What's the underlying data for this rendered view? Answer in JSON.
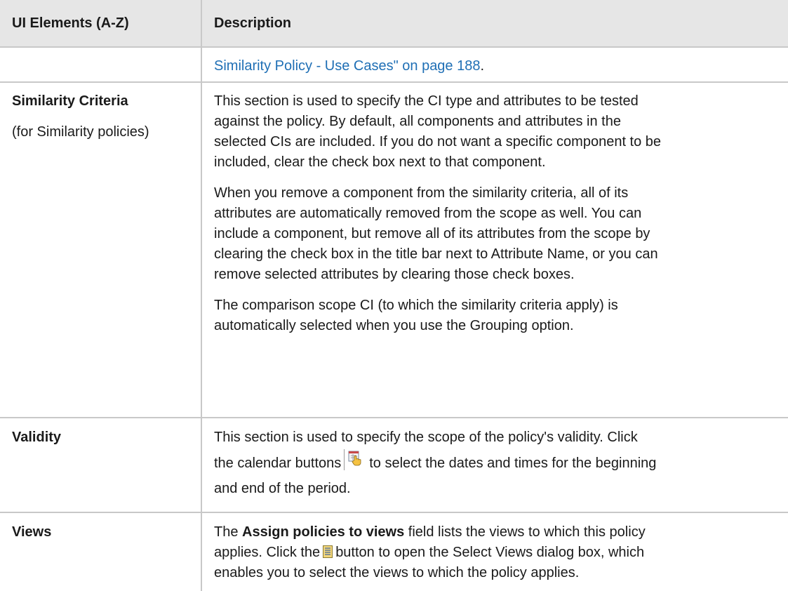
{
  "header": {
    "col1": "UI Elements (A-Z)",
    "col2": "Description"
  },
  "rows": [
    {
      "name": "",
      "desc": {
        "link": "Similarity Policy - Use Cases\" on page 188",
        "after": "."
      }
    },
    {
      "name": "Similarity Criteria",
      "subname": "(for Similarity policies)",
      "paragraphs": [
        [
          "This section is used to specify the CI type and attributes to be tested",
          "against the policy. By default, all components and attributes in the",
          "selected CIs are included. If you do not want a specific component to be",
          "included, clear the check box next to that component."
        ],
        [
          "When you remove a component from the similarity criteria, all of its",
          "attributes are automatically removed from the scope as well. You can",
          "include a component, but remove all of its attributes from the scope by",
          "clearing the check box in the title bar next to Attribute Name, or you can",
          "remove selected attributes by clearing those check boxes."
        ],
        [
          "The comparison scope CI (to which the similarity criteria apply) is",
          "automatically selected when you use the Grouping option."
        ]
      ]
    },
    {
      "name": "Validity",
      "lines": {
        "l1": "This section is used to specify the scope of the policy's validity. Click",
        "l2a": "the calendar buttons",
        "l2b": "to select the dates and times for the beginning",
        "l3": "and end of the period."
      }
    },
    {
      "name": "Views",
      "lines": {
        "l1a": "The",
        "l1bold": "Assign policies to views",
        "l1b": "field lists the views to which this policy",
        "l2a": "applies. Click the",
        "l2b": "button to open the Select Views dialog box, which",
        "l3": "enables you to select the views to which the policy applies."
      }
    }
  ],
  "icons": {
    "calendar": "calendar-icon",
    "views": "views-list-icon"
  },
  "colors": {
    "header_bg": "#e6e6e6",
    "border": "#c8c8c8",
    "link": "#1f6fb5"
  }
}
